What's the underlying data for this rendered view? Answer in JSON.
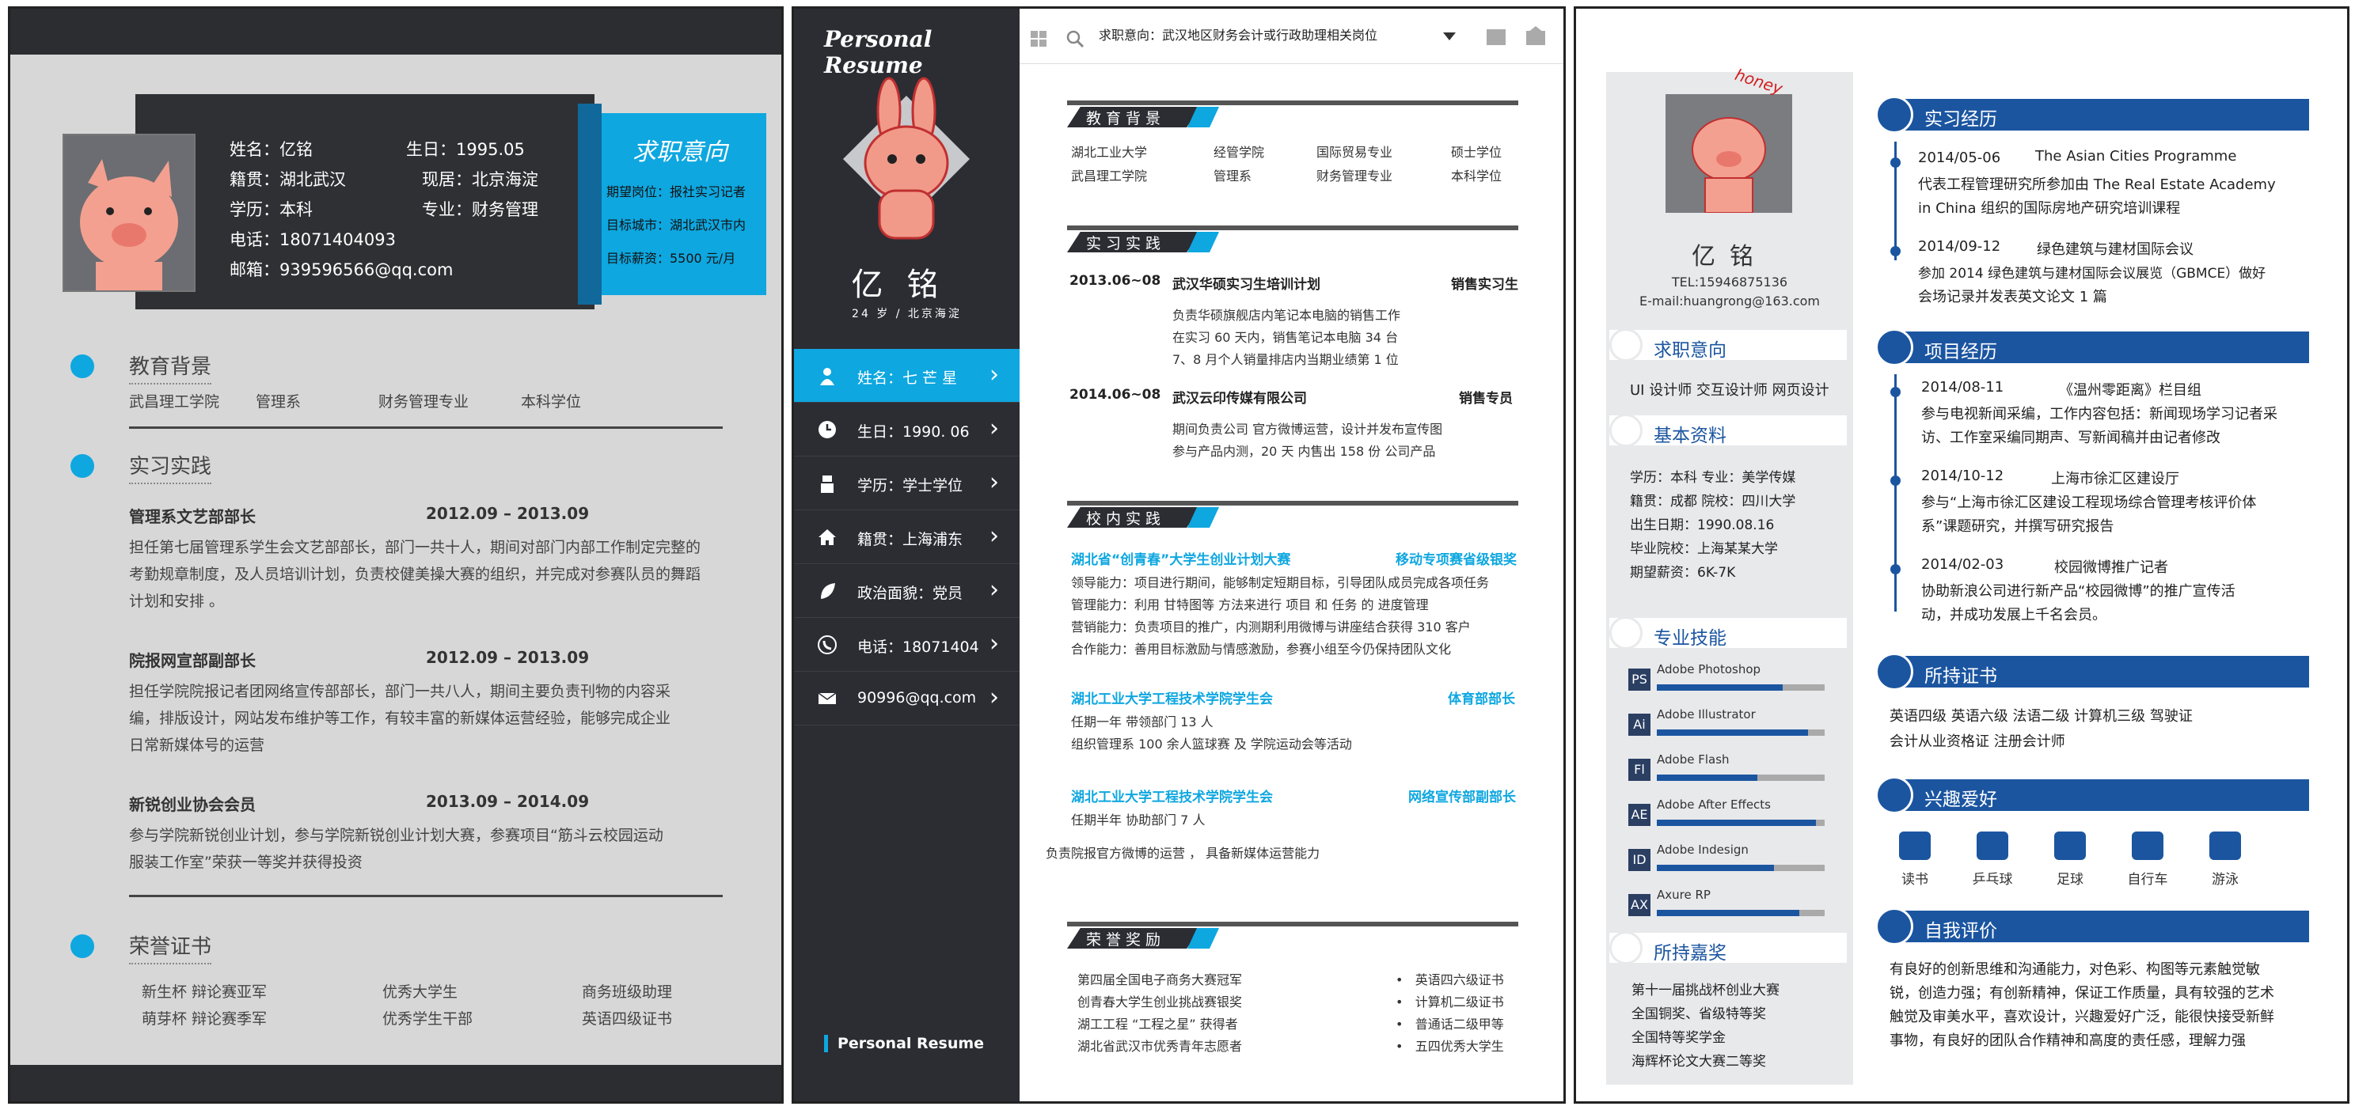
{
  "panel1": {
    "info": {
      "name": "姓名：亿铭",
      "birth": "生日：1995.05",
      "origin": "籍贯：湖北武汉",
      "current": "现居：北京海淀",
      "edu": "学历：本科",
      "major": "专业：财务管理",
      "phone": "电话：18071404093",
      "email": "邮箱：939596566@qq.com"
    },
    "intent": {
      "title": "求职意向",
      "position": "期望岗位：报社实习记者",
      "city": "目标城市：湖北武汉市内",
      "salary": "目标薪资：5500 元/月"
    },
    "education": {
      "title": "教育背景",
      "school": "武昌理工学院",
      "dept": "管理系",
      "major": "财务管理专业",
      "degree": "本科学位"
    },
    "practice": {
      "title": "实习实践",
      "items": [
        {
          "role": "管理系文艺部部长",
          "date": "2012.09 – 2013.09",
          "lines": [
            "担任第七届管理系学生会文艺部部长，部门一共十人，期间对部门内部工作制定完整的",
            "考勤规章制度，及人员培训计划，负责校健美操大赛的组织，并完成对参赛队员的舞蹈",
            "计划和安排 。"
          ]
        },
        {
          "role": "院报网宣部副部长",
          "date": "2012.09 – 2013.09",
          "lines": [
            "担任学院院报记者团网络宣传部部长，部门一共八人，期间主要负责刊物的内容采",
            "编，排版设计，网站发布维护等工作，有较丰富的新媒体运营经验，能够完成企业",
            "日常新媒体号的运营"
          ]
        },
        {
          "role": "新锐创业协会会员",
          "date": "2013.09 – 2014.09",
          "lines": [
            "参与学院新锐创业计划，参与学院新锐创业计划大赛，参赛项目“筋斗云校园运动",
            "服装工作室”荣获一等奖并获得投资"
          ]
        }
      ]
    },
    "honors": {
      "title": "荣誉证书",
      "col1": [
        "新生杯   辩论赛亚军",
        "萌芽杯   辩论赛季军"
      ],
      "col2": [
        "优秀大学生",
        "优秀学生干部"
      ],
      "col3": [
        "商务班级助理",
        "英语四级证书"
      ]
    }
  },
  "panel2": {
    "title": "Personal  Resume",
    "name": "亿铭",
    "age_loc": "24 岁   /   北京海淀",
    "sidebar": [
      {
        "label": "姓名：七 芒 星",
        "icon": "person-icon"
      },
      {
        "label": "生日：1990. 06",
        "icon": "clock-icon"
      },
      {
        "label": "学历：学士学位",
        "icon": "graduate-icon"
      },
      {
        "label": "籍贯：上海浦东",
        "icon": "home-icon"
      },
      {
        "label": "政治面貌：党员",
        "icon": "leaf-icon"
      },
      {
        "label": "电话：18071404",
        "icon": "phone-icon"
      },
      {
        "label": "90996@qq.com",
        "icon": "mail-icon"
      }
    ],
    "footer": "Personal  Resume",
    "search": "求职意向：武汉地区财务会计或行政助理相关岗位",
    "edu_title": "教育背景",
    "edu_rows": [
      [
        "湖北工业大学",
        "经管学院",
        "国际贸易专业",
        "硕士学位"
      ],
      [
        "武昌理工学院",
        "管理系",
        "财务管理专业",
        "本科学位"
      ]
    ],
    "intern_title": "实习实践",
    "interns": [
      {
        "date": "2013.06~08",
        "company": "武汉华硕实习生培训计划",
        "role": "销售实习生",
        "lines": [
          "负责华硕旗舰店内笔记本电脑的销售工作",
          "在实习 60 天内，销售笔记本电脑 34 台",
          "7、8 月个人销量排店内当期业绩第 1 位"
        ]
      },
      {
        "date": "2014.06~08",
        "company": "武汉云印传媒有限公司",
        "role": "销售专员",
        "lines": [
          "期间负责公司 官方微博运营，设计并发布宣传图",
          "参与产品内测，20 天 内售出 158 份 公司产品"
        ]
      }
    ],
    "campus_title": "校内实践",
    "campus": [
      {
        "org": "湖北省“创青春”大学生创业计划大赛",
        "role": "移动专项赛省级银奖",
        "lines": [
          "领导能力：项目进行期间，能够制定短期目标，引导团队成员完成各项任务",
          "管理能力：利用  甘特图等  方法来进行 项目 和 任务 的 进度管理",
          "营销能力：负责项目的推广，内测期利用微博与讲座结合获得 310 客户",
          "合作能力：善用目标激励与情感激励，参赛小组至今仍保持团队文化"
        ]
      },
      {
        "org": "湖北工业大学工程技术学院学生会",
        "role": "体育部部长",
        "lines": [
          "任期一年       带领部门 13 人",
          "组织管理系 100 余人篮球赛    及     学院运动会等活动"
        ]
      },
      {
        "org": "湖北工业大学工程技术学院学生会",
        "role": "网络宣传部副部长",
        "lines": [
          "任期半年       协助部门 7 人"
        ]
      }
    ],
    "campus_extra": "负责院报官方微博的运营    ，     具备新媒体运营能力",
    "awards_title": "荣誉奖励",
    "awards_left": [
      "第四届全国电子商务大赛冠军",
      "创青春大学生创业挑战赛银奖",
      "湖工工程  “工程之星” 获得者",
      "湖北省武汉市优秀青年志愿者"
    ],
    "awards_right": [
      "英语四六级证书",
      "计算机二级证书",
      "普通话二级甲等",
      "五四优秀大学生"
    ]
  },
  "panel3": {
    "name": "亿铭",
    "tel": "TEL:15946875136",
    "email": "E-mail:huangrong@163.com",
    "intent_title": "求职意向",
    "intent_text": "UI 设计师    交互设计师    网页设计",
    "basic_title": "基本资料",
    "basic": [
      "学历：本科        专业：美学传媒",
      "籍贯：成都        院校：四川大学",
      "出生日期：1990.08.16",
      "毕业院校：上海某某大学",
      "期望薪资：6K-7K"
    ],
    "skills_title": "专业技能",
    "skills": [
      {
        "abbr": "PS",
        "name": "Adobe Photoshop",
        "level": 0.75
      },
      {
        "abbr": "Ai",
        "name": "Adobe Illustrator",
        "level": 0.9
      },
      {
        "abbr": "Fl",
        "name": "Adobe Flash",
        "level": 0.6
      },
      {
        "abbr": "AE",
        "name": "Adobe After Effects",
        "level": 0.95
      },
      {
        "abbr": "ID",
        "name": "Adobe Indesign",
        "level": 0.7
      },
      {
        "abbr": "AX",
        "name": "Axure   RP",
        "level": 0.85
      }
    ],
    "awards_title": "所持嘉奖",
    "awards": [
      "第十一届挑战杯创业大赛",
      "全国铜奖、省级特等奖",
      "全国特等奖学金",
      "海辉杯论文大赛二等奖"
    ],
    "intern_title": "实习经历",
    "interns": [
      {
        "date": "2014/05-06",
        "head": "The Asian Cities Programme",
        "lines": [
          "代表工程管理研究所参加由 The Real Estate Academy",
          "in China   组织的国际房地产研究培训课程"
        ]
      },
      {
        "date": "2014/09-12",
        "head": "绿色建筑与建材国际会议",
        "lines": [
          "参加 2014 绿色建筑与建材国际会议展览（GBMCE）做好",
          "会场记录并发表英文论文 1 篇"
        ]
      }
    ],
    "project_title": "项目经历",
    "projects": [
      {
        "date": "2014/08-11",
        "head": "《温州零距离》栏目组",
        "lines": [
          "参与电视新闻采编，工作内容包括：新闻现场学习记者采",
          "访、工作室采编同期声、写新闻稿并由记者修改"
        ]
      },
      {
        "date": "2014/10-12",
        "head": "上海市徐汇区建设厅",
        "lines": [
          "参与“上海市徐汇区建设工程现场综合管理考核评价体",
          "系”课题研究，并撰写研究报告"
        ]
      },
      {
        "date": "2014/02-03",
        "head": "校园微博推广记者",
        "lines": [
          "协助新浪公司进行新产品“校园微博”的推广宣传活",
          "动，并成功发展上千名会员。"
        ]
      }
    ],
    "cert_title": "所持证书",
    "certs": [
      "英语四级    英语六级    法语二级  计算机三级    驾驶证",
      "会计从业资格证    注册会计师"
    ],
    "hobby_title": "兴趣爱好",
    "hobbies": [
      {
        "label": "读书",
        "icon": "book-icon"
      },
      {
        "label": "乒乓球",
        "icon": "pingpong-icon"
      },
      {
        "label": "足球",
        "icon": "football-icon"
      },
      {
        "label": "自行车",
        "icon": "bicycle-icon"
      },
      {
        "label": "游泳",
        "icon": "swim-icon"
      }
    ],
    "eval_title": "自我评价",
    "eval": [
      "有良好的创新思维和沟通能力，对色彩、构图等元素触觉敏",
      "锐，创造力强；有创新精神，保证工作质量，具有较强的艺术",
      "触觉及审美水平，喜欢设计，兴趣爱好广泛，能很快接受新鲜",
      "事物，有良好的团队合作精神和高度的责任感，理解力强"
    ],
    "sticker": "honey"
  }
}
